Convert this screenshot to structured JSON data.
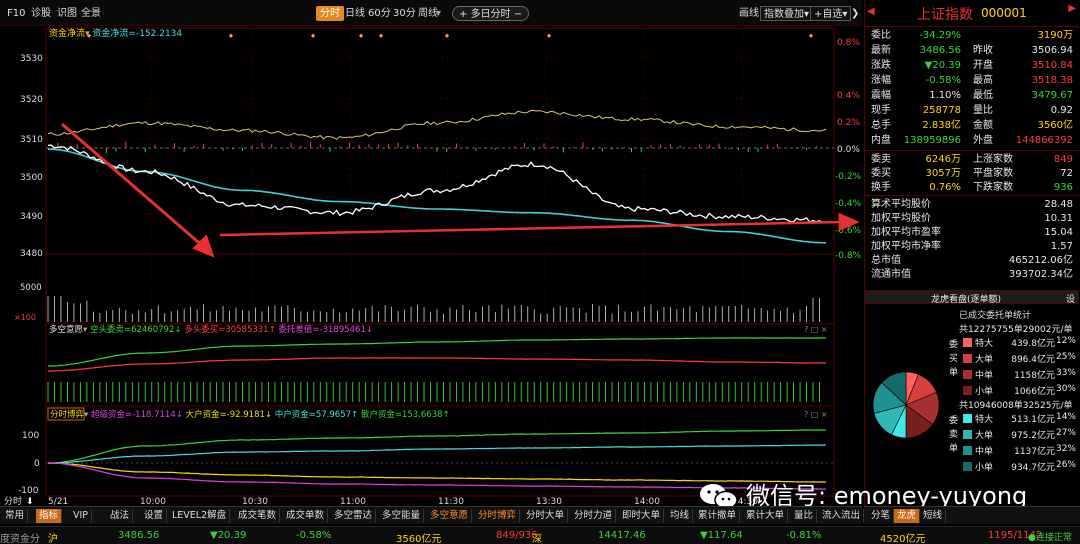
{
  "toolbar": {
    "f10": "F10",
    "diagnose": "诊股",
    "knowledge": "识图",
    "fullview": "全景",
    "tab_timeshare": "分时",
    "tab_day": "日线",
    "tab_60": "60分",
    "tab_30": "30分",
    "tab_week": "周线",
    "multiday": "多日分时",
    "draw": "画线",
    "indicator_overlay": "指数叠加",
    "add_watch": "自选"
  },
  "main_chart": {
    "legend_fund": "资金净流",
    "legend_fund_value": "资金净流=-152.2134",
    "y_left": [
      "3530",
      "3520",
      "3510",
      "3500",
      "3490",
      "3480"
    ],
    "y_right": [
      "0.8%",
      "0.4%",
      "0.2%",
      "0.0%",
      "-0.2%",
      "-0.4%",
      "-0.6%",
      "-0.8%"
    ],
    "vol_labels": [
      "5000",
      "×100"
    ]
  },
  "panel2": {
    "title": "多空意愿",
    "items": [
      "空头委卖=62460792",
      "多头委买=30585331",
      "委托差值=-31895461"
    ]
  },
  "panel3": {
    "title": "分时博弈",
    "items": [
      "超级资金=-118.7114",
      "大户资金=-92.9181",
      "中户资金=57.9657",
      "散户资金=153.6638"
    ],
    "y_labels": [
      "100",
      "0",
      "-100"
    ]
  },
  "time_axis": {
    "label": "分时",
    "date": "5/21",
    "ticks": [
      "10:00",
      "10:30",
      "11:00",
      "11:30",
      "13:30",
      "14:00",
      "14:30"
    ]
  },
  "chart_data": {
    "type": "line",
    "xlabel": "",
    "ylabel": "",
    "x": [
      "09:30",
      "10:00",
      "10:30",
      "11:00",
      "11:30",
      "13:30",
      "14:00",
      "14:30",
      "15:00"
    ],
    "ylim": [
      3478,
      3533
    ],
    "series": [
      {
        "name": "",
        "values": [
          3507,
          3500,
          3491,
          3489,
          3495,
          3502,
          3490,
          3488,
          3487
        ]
      },
      {
        "name": "",
        "values": [
          3506,
          3500,
          3495,
          3492,
          3490,
          3489,
          3487,
          3484,
          3481
        ]
      }
    ]
  },
  "right_panel": {
    "title": "上证指数",
    "code": "000001",
    "rows_a": [
      {
        "k1": "委比",
        "v1": "-34.29%",
        "k2": "",
        "v2": "3190万"
      },
      {
        "k1": "最新",
        "v1": "3486.56",
        "k2": "昨收",
        "v2": "3506.94"
      },
      {
        "k1": "涨跌",
        "v1": "▼20.39",
        "k2": "开盘",
        "v2": "3510.84"
      },
      {
        "k1": "涨幅",
        "v1": "-0.58%",
        "k2": "最高",
        "v2": "3518.38"
      },
      {
        "k1": "震幅",
        "v1": "1.10%",
        "k2": "最低",
        "v2": "3479.67"
      },
      {
        "k1": "现手",
        "v1": "258778",
        "k2": "量比",
        "v2": "0.92"
      },
      {
        "k1": "总手",
        "v1": "2.838亿",
        "k2": "金额",
        "v2": "3560亿"
      },
      {
        "k1": "内盘",
        "v1": "138959896",
        "k2": "外盘",
        "v2": "144866392"
      }
    ],
    "rows_b": [
      {
        "k1": "委卖",
        "v1": "6246万",
        "k2": "上涨家数",
        "v2": "849"
      },
      {
        "k1": "委买",
        "v1": "3057万",
        "k2": "平盘家数",
        "v2": "72"
      },
      {
        "k1": "换手",
        "v1": "0.76%",
        "k2": "下跌家数",
        "v2": "936"
      }
    ],
    "rows_c": [
      {
        "k": "算术平均股价",
        "v": "28.48"
      },
      {
        "k": "加权平均股价",
        "v": "10.31"
      },
      {
        "k": "加权平均市盈率",
        "v": "15.04"
      },
      {
        "k": "加权平均市净率",
        "v": "1.57"
      },
      {
        "k": "总市值",
        "v": "465212.06亿"
      },
      {
        "k": "流通市值",
        "v": "393702.34亿"
      }
    ],
    "dragon_title": "龙虎看盘(逐单额)",
    "settings": "设",
    "order_stats_title": "已成交委托单统计",
    "buy_total": "共12275755单29002元/单",
    "sell_total": "共10946008单32525元/单",
    "buy_side": [
      "委",
      "买",
      "单"
    ],
    "sell_side": [
      "委",
      "卖",
      "单"
    ],
    "buy_rows": [
      {
        "name": "特大",
        "amt": "439.8亿元",
        "pct": "12%",
        "color": "#ff6060"
      },
      {
        "name": "大单",
        "amt": "896.4亿元",
        "pct": "25%",
        "color": "#d84040"
      },
      {
        "name": "中单",
        "amt": "1158亿元",
        "pct": "33%",
        "color": "#a83030"
      },
      {
        "name": "小单",
        "amt": "1066亿元",
        "pct": "30%",
        "color": "#782020"
      }
    ],
    "sell_rows": [
      {
        "name": "特大",
        "amt": "513.1亿元",
        "pct": "14%",
        "color": "#40e8e8"
      },
      {
        "name": "大单",
        "amt": "975.2亿元",
        "pct": "27%",
        "color": "#30b8b8"
      },
      {
        "name": "中单",
        "amt": "1137亿元",
        "pct": "32%",
        "color": "#209090"
      },
      {
        "name": "小单",
        "amt": "934.7亿元",
        "pct": "26%",
        "color": "#156a6a"
      }
    ],
    "tabs": [
      "分笔",
      "龙虎",
      "短线"
    ]
  },
  "bottom_tabs": [
    "常用",
    "指标",
    "VIP",
    "战法",
    "设置",
    "LEVEL2解盘",
    "成交笔数",
    "成交单数",
    "多空雷达",
    "多空能量",
    "多空意愿",
    "分时博弈",
    "分时大单",
    "分时力道",
    "即时大单",
    "均线",
    "累计撤单",
    "累计大单",
    "量比",
    "流入流出",
    "委比",
    "新单撤单"
  ],
  "ticker": {
    "sh_label": "沪",
    "sh_price": "3486.56",
    "sh_chg": "▼20.39",
    "sh_pct": "-0.58%",
    "sh_amt": "3560亿元",
    "sh_ud": "849/936",
    "sz_label": "深",
    "sz_price": "14417.46",
    "sz_chg": "▼117.64",
    "sz_pct": "-0.81%",
    "sz_amt": "4520亿元",
    "counts": "1195/1142",
    "conn": "连接正常",
    "left_text": "度资金分"
  },
  "watermark": "微信号: emoney-yuyong"
}
